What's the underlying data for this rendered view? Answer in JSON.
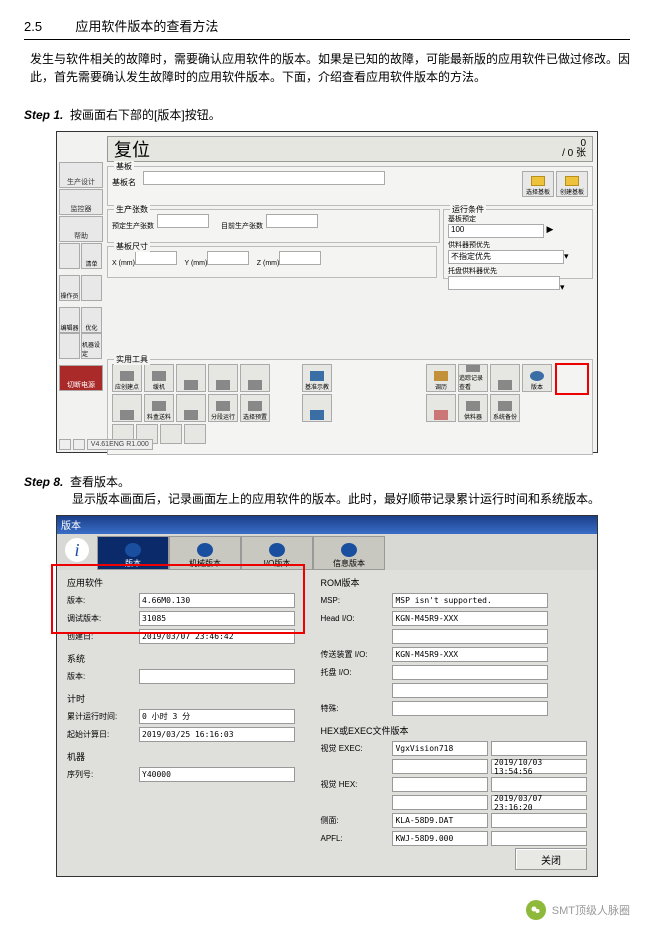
{
  "section": {
    "num": "2.5",
    "title": "应用软件版本的查看方法"
  },
  "intro": "发生与软件相关的故障时，需要确认应用软件的版本。如果是已知的故障，可能最新版的应用软件已做过修改。因此，首先需要确认发生故障时的应用软件版本。下面，介绍查看应用软件版本的方法。",
  "step1": {
    "label": "Step 1.",
    "text": "按画面右下部的[版本]按钮。"
  },
  "step8": {
    "label": "Step 8.",
    "line1": "查看版本。",
    "line2": "显示版本画面后，记录画面左上的应用软件的版本。此时，最好顺带记录累计运行时间和系统版本。"
  },
  "fig1": {
    "title": "复位",
    "counter_top": "0",
    "counter_bottom": "/ 0 张",
    "sidebar": [
      "生产设计",
      "监控器",
      "帮助",
      "",
      "清单",
      "操作员",
      "编辑器",
      "优化",
      "机器设定",
      "切断电源"
    ],
    "panel_board": {
      "label": "基板",
      "sub": "基板名",
      "btn_sel": "选择基板",
      "btn_new": "创建基板"
    },
    "panel_prod": {
      "label": "生产张数",
      "left": "预定生产张数",
      "right": "目前生产张数"
    },
    "panel_cond": {
      "label": "运行条件",
      "field": "基板预定",
      "val": "100",
      "prio_label": "供料器预优先",
      "prio_val": "不指定优先",
      "tray": "托盘供料器优先"
    },
    "panel_size": {
      "label": "基板尺寸",
      "x": "X (mm)",
      "y": "Y (mm)",
      "z": "Z (mm)"
    },
    "panel_util": {
      "label": "实用工具"
    },
    "tools_row1": [
      "应创建点",
      "缓机",
      "",
      "",
      "",
      "",
      "基准示教",
      "",
      "调历",
      "追踪记录查看",
      "",
      "版本"
    ],
    "tools_row2": [
      "",
      "料盒送料",
      "",
      "分段运行",
      "选择预置",
      "",
      "",
      "供料器",
      "系统备份"
    ],
    "statusbar": [
      "",
      "",
      "V4.61ENG R1.000"
    ]
  },
  "fig2": {
    "window_title": "版本",
    "tabs": [
      "版本",
      "机械版本",
      "I/O版本",
      "信息版本"
    ],
    "info_glyph": "i",
    "app": {
      "title": "应用软件",
      "rows": [
        {
          "lab": "版本:",
          "val": "4.66M0.130"
        },
        {
          "lab": "调试版本:",
          "val": "31085"
        },
        {
          "lab": "创建日:",
          "val": "2019/03/07 23:46:42"
        }
      ]
    },
    "system": {
      "title": "系统",
      "rows": [
        {
          "lab": "版本:",
          "val": ""
        }
      ]
    },
    "timer": {
      "title": "计时",
      "rows": [
        {
          "lab": "累计运行时间:",
          "val": "0 小时 3 分"
        },
        {
          "lab": "起始计算日:",
          "val": "2019/03/25 16:16:03"
        }
      ]
    },
    "machine": {
      "title": "机器",
      "rows": [
        {
          "lab": "序列号:",
          "val": "Y40000"
        }
      ]
    },
    "rom": {
      "title": "ROM版本",
      "rows": [
        {
          "lab": "MSP:",
          "val": "MSP isn't supported."
        },
        {
          "lab": "Head I/O:",
          "val": "KGN-M45R9-XXX"
        },
        {
          "lab": "",
          "val": ""
        },
        {
          "lab": "传送装置 I/O:",
          "val": "KGN-M45R9-XXX"
        },
        {
          "lab": "托盘 I/O:",
          "val": ""
        },
        {
          "lab": "",
          "val": ""
        },
        {
          "lab": "特殊:",
          "val": ""
        }
      ]
    },
    "hex": {
      "title": "HEX或EXEC文件版本",
      "rows": [
        {
          "lab": "视觉 EXEC:",
          "val": "VgxVision718",
          "val2": ""
        },
        {
          "lab": "",
          "val": "",
          "val2": "2019/10/03 13:54:56"
        },
        {
          "lab": "视觉 HEX:",
          "val": "",
          "val2": ""
        },
        {
          "lab": "",
          "val": "",
          "val2": "2019/03/07 23:16:20"
        },
        {
          "lab": "侧面:",
          "val": "KLA-58D9.DAT",
          "val2": ""
        },
        {
          "lab": "APFL:",
          "val": "KWJ-58D9.000",
          "val2": ""
        }
      ]
    },
    "close": "关闭"
  },
  "watermark": "SMT顶级人脉圈"
}
